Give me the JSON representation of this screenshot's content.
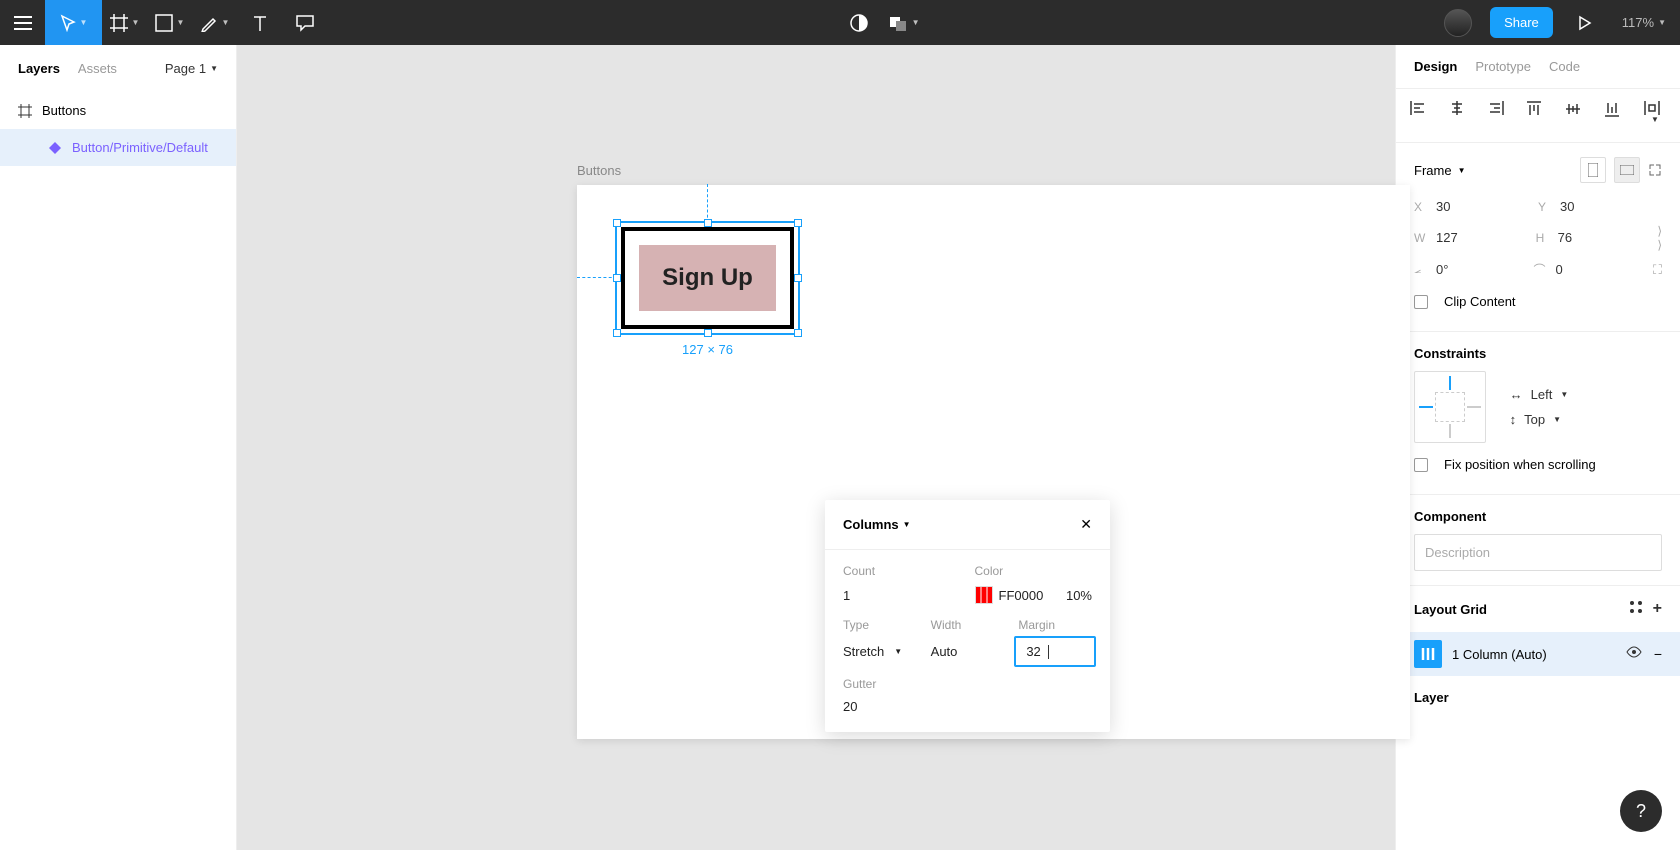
{
  "toolbar": {
    "share": "Share",
    "zoom": "117%"
  },
  "leftPanel": {
    "tabs": {
      "layers": "Layers",
      "assets": "Assets"
    },
    "page": "Page 1",
    "frame": "Buttons",
    "selectedLayer": "Button/Primitive/Default"
  },
  "canvas": {
    "frameLabel": "Buttons",
    "buttonText": "Sign Up",
    "dims": "127 × 76"
  },
  "popup": {
    "title": "Columns",
    "labels": {
      "count": "Count",
      "color": "Color",
      "type": "Type",
      "width": "Width",
      "margin": "Margin",
      "gutter": "Gutter"
    },
    "count": "1",
    "colorHex": "FF0000",
    "colorOpacity": "10%",
    "type": "Stretch",
    "width": "Auto",
    "margin": "32",
    "gutter": "20"
  },
  "right": {
    "tabs": {
      "design": "Design",
      "prototype": "Prototype",
      "code": "Code"
    },
    "frame": "Frame",
    "x": "30",
    "y": "30",
    "w": "127",
    "h": "76",
    "rot": "0°",
    "rad": "0",
    "clip": "Clip Content",
    "constraints": "Constraints",
    "left": "Left",
    "top": "Top",
    "fix": "Fix position when scrolling",
    "component": "Component",
    "descPlaceholder": "Description",
    "layoutGrid": "Layout Grid",
    "gridRow": "1 Column (Auto)",
    "layer": "Layer"
  }
}
